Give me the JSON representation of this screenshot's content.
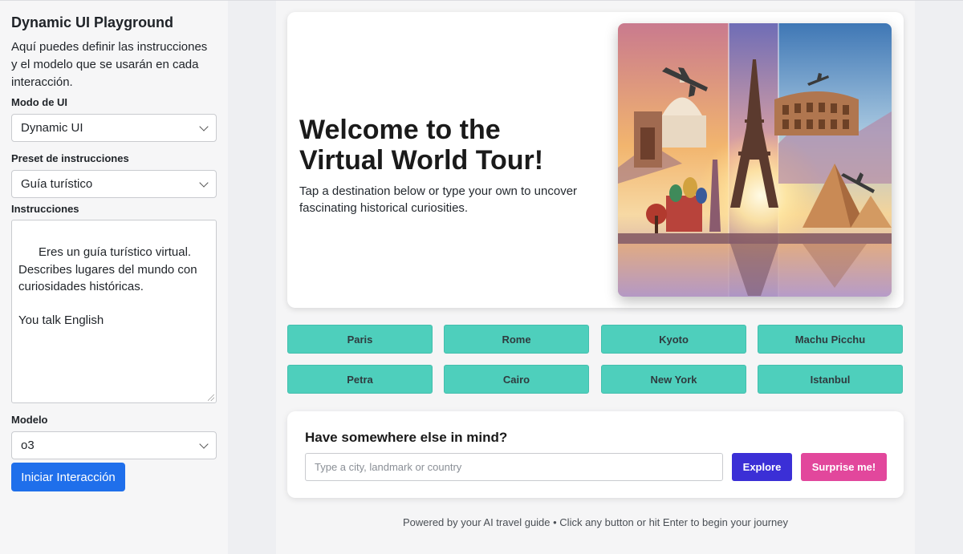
{
  "sidebar": {
    "title": "Dynamic UI Playground",
    "description": "Aquí puedes definir las instrucciones y el modelo que se usarán en cada interacción.",
    "ui_mode": {
      "label": "Modo de UI",
      "value": "Dynamic UI"
    },
    "preset": {
      "label": "Preset de instrucciones",
      "value": "Guía turístico"
    },
    "instructions": {
      "label": "Instrucciones",
      "value": "Eres un guía turístico virtual. Describes lugares del mundo con curiosidades históricas.\n\nYou talk English"
    },
    "model": {
      "label": "Modelo",
      "value": "o3"
    },
    "start_button": "Iniciar Interacción"
  },
  "hero": {
    "title": "Welcome to the Virtual World Tour!",
    "subtitle": "Tap a destination below or type your own to uncover fascinating historical curiosities."
  },
  "destinations": [
    "Paris",
    "Rome",
    "Kyoto",
    "Machu Picchu",
    "Petra",
    "Cairo",
    "New York",
    "Istanbul"
  ],
  "custom": {
    "title": "Have somewhere else in mind?",
    "placeholder": "Type a city, landmark or country",
    "explore_label": "Explore",
    "surprise_label": "Surprise me!"
  },
  "footer": "Powered by your AI travel guide • Click any button or hit Enter to begin your journey",
  "colors": {
    "primary_blue": "#1f6feb",
    "teal": "#4ecfbc",
    "explore": "#3b2fd6",
    "surprise": "#e2479c"
  }
}
